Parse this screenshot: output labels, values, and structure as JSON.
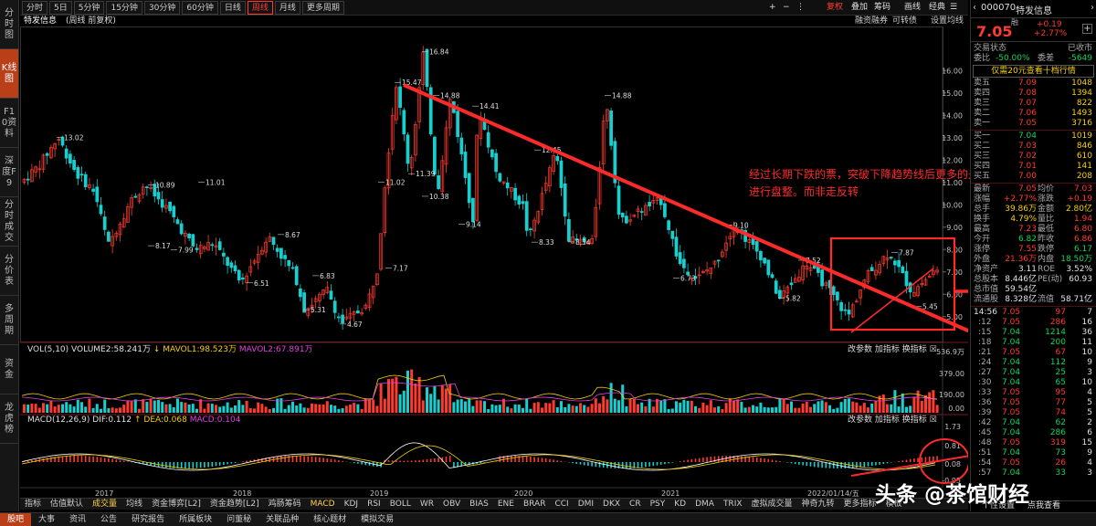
{
  "colors": {
    "up": "#ff3b30",
    "down": "#15d0d0",
    "accent": "#b83f17",
    "ma_yellow": "#f5d000",
    "ma_pink": "#e040e0"
  },
  "sidebar": [
    "分时图",
    "K线图",
    "F10资料",
    "深度F9",
    "分时成交",
    "分价表",
    "多周期",
    "资金",
    "龙虎榜"
  ],
  "toolbar": {
    "periods": [
      "分时",
      "5日",
      "5分钟",
      "15分钟",
      "30分钟",
      "60分钟",
      "日线",
      "周线",
      "月线",
      "更多周期"
    ],
    "right": [
      "+",
      "−",
      "⋮",
      "复权",
      "叠加",
      "筹码",
      "画线",
      "经典",
      "☰"
    ]
  },
  "info": {
    "stock": "特发信息",
    "mode": "(周线 前复权)",
    "tools": [
      "可转债",
      "融资融券",
      "设置均线"
    ]
  },
  "kline": {
    "y_ticks": [
      "16.00",
      "15.00",
      "14.00",
      "13.00",
      "12.00",
      "11.00",
      "10.00",
      "9.00",
      "8.00",
      "7.00",
      "6.00",
      "5.00"
    ],
    "price_labels": [
      "16.84",
      "15.47",
      "14.88",
      "14.41",
      "14.88",
      "13.02",
      "12.45",
      "11.02",
      "11.39",
      "10.38",
      "10.89",
      "11.01",
      "9.14",
      "9.10",
      "8.17",
      "7.99",
      "8.67",
      "8.33",
      "8.34",
      "7.17",
      "7.52",
      "7.87",
      "6.51",
      "6.83",
      "6.73",
      "5.82",
      "5.45",
      "5.31",
      "4.67"
    ]
  },
  "annotation": "经过长期下跌的票，突破下降趋势线后更多的是进行盘整。而非走反转",
  "vol": {
    "title": "VOL(5,10)",
    "vol": "VOLUME2:58.241万",
    "ma1": "MAVOL1:98.523万",
    "ma2": "MAVOL2:67.891万",
    "buttons": [
      "改参数",
      "加指标",
      "换指标"
    ],
    "y_ticks": [
      "536.9万",
      "379.00",
      "190.00",
      "0.00"
    ]
  },
  "macd": {
    "title": "MACD(12,26,9)",
    "dif": "DIF:0.112",
    "dea": "DEA:0.068",
    "macd": "MACD:0.104",
    "buttons": [
      "改参数",
      "加指标",
      "换指标"
    ],
    "y_ticks": [
      "1.73",
      "0.81",
      "0.08",
      "-0.95"
    ]
  },
  "x_axis": [
    "2017",
    "2018",
    "2019",
    "2020",
    "2021",
    "2022/01/14/五"
  ],
  "bottom_indicators": [
    "指标",
    "估值默认",
    "成交量",
    "均线",
    "资金博弈[L2]",
    "资金趋势[L2]",
    "鸡肠筹码",
    "MACD",
    "KDJ",
    "RSI",
    "BOLL",
    "WR",
    "OBV",
    "BIAS",
    "ENE",
    "BRAR",
    "CCI",
    "DMI",
    "DKX",
    "CR",
    "PSY",
    "KD",
    "DMA",
    "TRIX",
    "虚拟成交量",
    "神奇九转",
    "更多指标",
    "模板"
  ],
  "bottom_tabs": [
    "股吧",
    "大事",
    "资讯",
    "公告",
    "研究报告",
    "所属板块",
    "问董秘",
    "关联品种",
    "核心题材",
    "模拟交易"
  ],
  "quote": {
    "code": "000070",
    "name": "特发信息",
    "tag": "融",
    "price": "7.05",
    "change": "+0.19",
    "pct": "+2.77%",
    "status_label": "交易状态",
    "status_value": "已收市",
    "ratio": [
      "委比",
      "-50.00%",
      "委差",
      "-5649"
    ],
    "promo": "仅需20元查看十档行情",
    "asks": [
      [
        "卖五",
        "7.09",
        "1048"
      ],
      [
        "卖四",
        "7.08",
        "1394"
      ],
      [
        "卖三",
        "7.07",
        "822"
      ],
      [
        "卖二",
        "7.06",
        "1493"
      ],
      [
        "卖一",
        "7.05",
        "3716"
      ]
    ],
    "bids": [
      [
        "买一",
        "7.04",
        "1019"
      ],
      [
        "买二",
        "7.03",
        "846"
      ],
      [
        "买三",
        "7.02",
        "610"
      ],
      [
        "买四",
        "7.01",
        "141"
      ],
      [
        "买五",
        "7.00",
        "208"
      ]
    ],
    "stats": [
      [
        "最新",
        "7.05",
        "均价",
        "7.03"
      ],
      [
        "涨幅",
        "+2.77%",
        "涨跌",
        "+0.19"
      ],
      [
        "总手",
        "39.86万",
        "金额",
        "2.80亿"
      ],
      [
        "换手",
        "4.79%",
        "量比",
        "1.94"
      ],
      [
        "最高",
        "7.23",
        "最低",
        "6.80"
      ],
      [
        "今开",
        "6.82",
        "昨收",
        "6.86"
      ],
      [
        "涨停",
        "7.55",
        "跌停",
        "6.17"
      ],
      [
        "外盘",
        "21.36万",
        "内盘",
        "18.50万"
      ],
      [
        "净资产",
        "3.11",
        "ROE",
        "3.52%"
      ],
      [
        "总股本",
        "8.446亿",
        "PE(动)",
        "60.93"
      ],
      [
        "总市值",
        "59.54亿",
        "",
        " "
      ],
      [
        "流通股",
        "8.328亿",
        "流值",
        "58.71亿"
      ]
    ],
    "ticks": [
      [
        "14:56",
        "7.05",
        "97",
        "7"
      ],
      [
        "",
        ":12",
        "7.05",
        "286",
        "16"
      ],
      [
        "",
        ":15",
        "7.04",
        "1214",
        "36"
      ],
      [
        "",
        ":18",
        "7.04",
        "200",
        "11"
      ],
      [
        "",
        ":21",
        "7.05",
        "67",
        "10"
      ],
      [
        "",
        ":24",
        "7.04",
        "112",
        "9"
      ],
      [
        "",
        ":27",
        "7.04",
        "25",
        "3"
      ],
      [
        "",
        ":30",
        "7.04",
        "65",
        "10"
      ],
      [
        "",
        ":33",
        "7.05",
        "95",
        "4"
      ],
      [
        "",
        ":36",
        "7.05",
        "77",
        "5"
      ],
      [
        "",
        ":39",
        "7.05",
        "74",
        "5"
      ],
      [
        "",
        ":42",
        "7.04",
        "62",
        "2"
      ],
      [
        "",
        ":45",
        "7.04",
        "286",
        "6"
      ],
      [
        "",
        ":48",
        "7.05",
        "319",
        "15"
      ],
      [
        "",
        ":51",
        "7.04",
        "73",
        "9"
      ],
      [
        "",
        ":54",
        "7.05",
        "26",
        "4"
      ],
      [
        "",
        ":57",
        "7.04",
        "33",
        "3"
      ]
    ],
    "bottom": [
      "个性设置",
      "点我查看"
    ]
  },
  "watermark": "头条 @茶馆财经"
}
